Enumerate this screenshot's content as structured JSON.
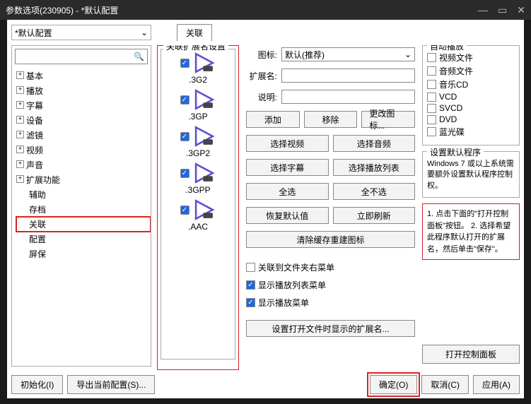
{
  "title": "参数选项(230905) - *默认配置",
  "config_combo": "*默认配置",
  "active_tab": "关联",
  "tree": [
    {
      "label": "基本",
      "plus": true
    },
    {
      "label": "播放",
      "plus": true
    },
    {
      "label": "字幕",
      "plus": true
    },
    {
      "label": "设备",
      "plus": true
    },
    {
      "label": "滤镜",
      "plus": true
    },
    {
      "label": "视频",
      "plus": true
    },
    {
      "label": "声音",
      "plus": true
    },
    {
      "label": "扩展功能",
      "plus": true
    },
    {
      "label": "辅助",
      "leaf": true
    },
    {
      "label": "存档",
      "leaf": true
    },
    {
      "label": "关联",
      "leaf": true,
      "sel": true
    },
    {
      "label": "配置",
      "leaf": true
    },
    {
      "label": "屏保",
      "leaf": true
    }
  ],
  "ext_panel_title": "关联扩展名设置",
  "extensions": [
    ".3G2",
    ".3GP",
    ".3GP2",
    ".3GPP",
    ".AAC"
  ],
  "form": {
    "icon_label": "图标:",
    "icon_value": "默认(推荐)",
    "ext_label": "扩展名:",
    "desc_label": "说明:"
  },
  "buttons": {
    "add": "添加",
    "remove": "移除",
    "change_icon": "更改图标...",
    "sel_video": "选择视频",
    "sel_audio": "选择音频",
    "sel_sub": "选择字幕",
    "sel_playlist": "选择播放列表",
    "sel_all": "全选",
    "sel_none": "全不选",
    "restore": "恢复默认值",
    "refresh": "立即刷新",
    "clear_cache": "清除缓存重建图标",
    "set_open_ext": "设置打开文件时显示的扩展名..."
  },
  "checkboxes": {
    "assoc_folder": "关联到文件夹右菜单",
    "show_playlist": "显示播放列表菜单",
    "show_play": "显示播放菜单"
  },
  "autoplay": {
    "title": "自动播放",
    "items": [
      "视频文件",
      "音频文件",
      "音乐CD",
      "VCD",
      "SVCD",
      "DVD",
      "蓝光碟"
    ]
  },
  "default_prog": {
    "title": "设置默认程序",
    "note": "Windows 7 或以上系统需要额外设置默认程序控制权。"
  },
  "help": "1. 点击下面的\"打开控制面板\"按钮。\n2. 选择希望此程序默认打开的扩展名，然后单击\"保存\"。",
  "open_cp": "打开控制面板",
  "footer": {
    "init": "初始化(I)",
    "export": "导出当前配置(S)...",
    "ok": "确定(O)",
    "cancel": "取消(C)",
    "apply": "应用(A)"
  }
}
